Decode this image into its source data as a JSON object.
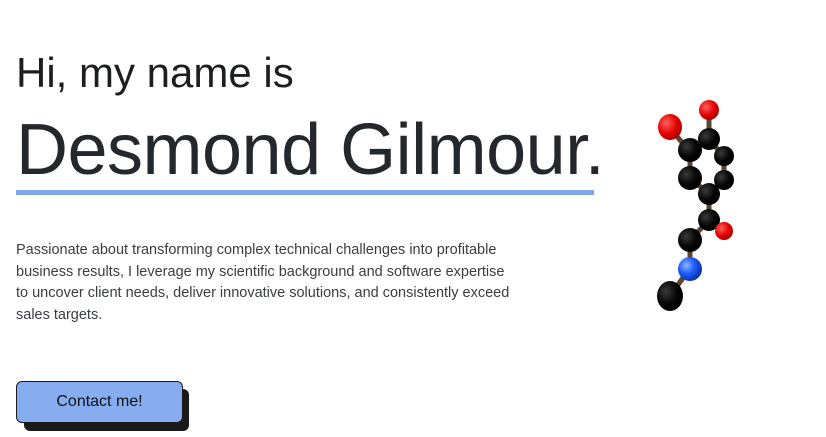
{
  "hero": {
    "greeting": "Hi, my name is",
    "name": "Desmond Gilmour.",
    "bio": "Passionate about transforming complex technical challenges into profitable business results, I leverage my scientific background and software expertise to uncover client needs, deliver innovative solutions, and consistently exceed sales targets.",
    "contact_button_label": "Contact me!"
  },
  "colors": {
    "accent": "#7fa6e8",
    "button_bg": "#86adf0",
    "text": "#24272b",
    "atom_carbon": "#000000",
    "atom_oxygen": "#e60000",
    "atom_nitrogen": "#1a5cff"
  },
  "molecule_image": {
    "icon": "molecule-3d-model"
  }
}
